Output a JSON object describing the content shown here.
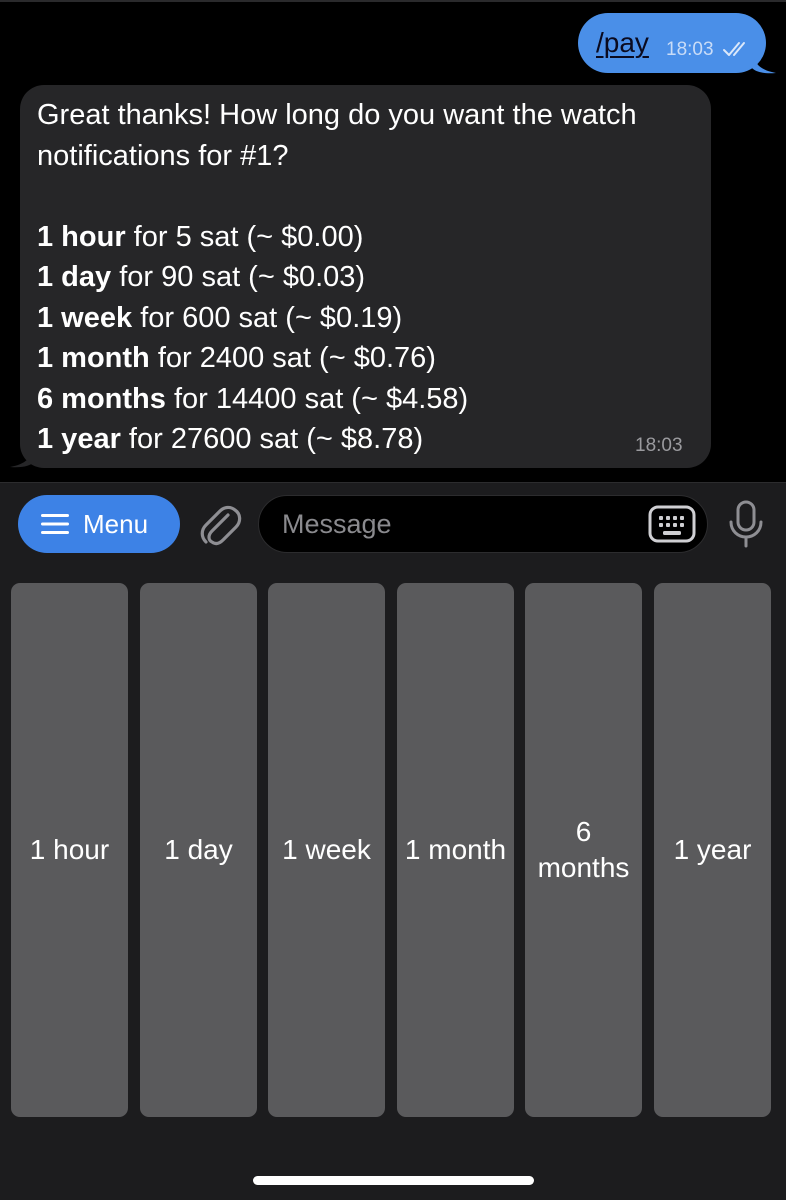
{
  "outgoing_message": {
    "text": "/pay",
    "time": "18:03",
    "status": "read",
    "bubble_color": "#4a8fe8"
  },
  "incoming_message": {
    "intro": "Great thanks! How long do you want the watch notifications for #1?",
    "intro_lines": [
      "Great thanks! How long do you want the watch",
      "notifications for #1?"
    ],
    "options": [
      {
        "label": "1 hour",
        "details": " for 5 sat (~ $0.00)"
      },
      {
        "label": "1 day",
        "details": " for 90 sat (~ $0.03)"
      },
      {
        "label": "1 week",
        "details": " for 600 sat (~ $0.19)"
      },
      {
        "label": "1 month",
        "details": " for 2400 sat (~ $0.76)"
      },
      {
        "label": "6 months",
        "details": " for 14400 sat (~ $4.58)"
      },
      {
        "label": "1 year",
        "details": " for 27600 sat (~ $8.78)"
      }
    ],
    "time": "18:03",
    "bubble_color": "#262628"
  },
  "composer": {
    "menu_label": "Menu",
    "menu_icon": "hamburger-icon",
    "attach_icon": "paperclip-icon",
    "placeholder": "Message",
    "keyboard_icon": "keyboard-icon",
    "mic_icon": "microphone-icon",
    "menu_color": "#3d82e6"
  },
  "reply_keyboard": {
    "buttons": [
      {
        "label": "1 hour"
      },
      {
        "label": "1 day"
      },
      {
        "label": "1 week"
      },
      {
        "label": "1 month"
      },
      {
        "label_lines": [
          "6",
          "months"
        ]
      },
      {
        "label": "1 year"
      }
    ],
    "button_color": "#5a5a5c"
  }
}
